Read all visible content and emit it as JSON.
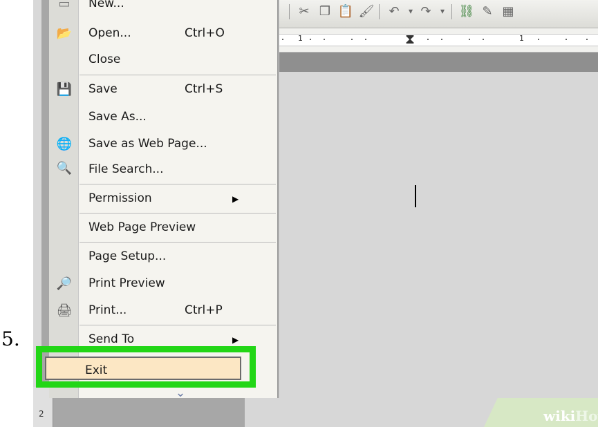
{
  "step": {
    "number": "5."
  },
  "menu": {
    "items": [
      {
        "label": "New...",
        "shortcut": "",
        "icon": "new-document-icon"
      },
      {
        "label": "Open...",
        "shortcut": "Ctrl+O",
        "icon": "folder-open-icon"
      },
      {
        "label": "Close",
        "shortcut": "",
        "icon": ""
      },
      {
        "label": "Save",
        "shortcut": "Ctrl+S",
        "icon": "save-disk-icon"
      },
      {
        "label": "Save As...",
        "shortcut": "",
        "icon": ""
      },
      {
        "label": "Save as Web Page...",
        "shortcut": "",
        "icon": "web-page-icon"
      },
      {
        "label": "File Search...",
        "shortcut": "",
        "icon": "search-icon"
      },
      {
        "label": "Permission",
        "shortcut": "",
        "icon": ""
      },
      {
        "label": "Web Page Preview",
        "shortcut": "",
        "icon": ""
      },
      {
        "label": "Page Setup...",
        "shortcut": "",
        "icon": ""
      },
      {
        "label": "Print Preview",
        "shortcut": "",
        "icon": "print-preview-icon"
      },
      {
        "label": "Print...",
        "shortcut": "Ctrl+P",
        "icon": "printer-icon"
      },
      {
        "label": "Send To",
        "shortcut": "",
        "icon": ""
      },
      {
        "label": "Exit",
        "shortcut": "",
        "icon": ""
      }
    ]
  },
  "ruler": {
    "mark_1": "1",
    "mark_2": "1"
  },
  "left_ruler": {
    "mark": "2"
  },
  "watermark": {
    "wiki": "wiki",
    "how": "How"
  },
  "colors": {
    "highlight": "#22d616",
    "exit_bg": "#fce7c4"
  }
}
